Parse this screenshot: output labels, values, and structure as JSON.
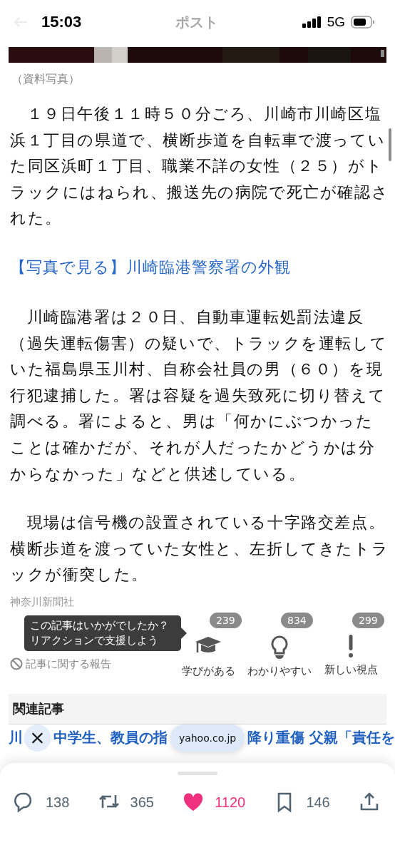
{
  "status_bar": {
    "time": "15:03",
    "network": "5G"
  },
  "header": {
    "title": "ポスト"
  },
  "article": {
    "photo_caption": "（資料写真）",
    "blocks": [
      {
        "kind": "paragraph",
        "text": "　１９日午後１１時５０分ごろ、川崎市川崎区塩浜１丁目の県道で、横断歩道を自転車で渡っていた同区浜町１丁目、職業不詳の女性（２５）がトラックにはねられ、搬送先の病院で死亡が確認された。"
      },
      {
        "kind": "link",
        "text": "【写真で見る】川崎臨港警察署の外観"
      },
      {
        "kind": "paragraph",
        "text": "　川崎臨港署は２０日、自動車運転処罰法違反（過失運転傷害）の疑いで、トラックを運転していた福島県玉川村、自称会社員の男（６０）を現行犯逮捕した。署は容疑を過失致死に切り替えて調べる。署によると、男は「何かにぶつかったことは確かだが、それが人だったかどうかは分からなかった」などと供述している。"
      },
      {
        "kind": "paragraph",
        "text": "　現場は信号機の設置されている十字路交差点。横断歩道を渡っていた女性と、左折してきたトラックが衝突した。"
      }
    ],
    "source": "神奈川新聞社"
  },
  "reactions": {
    "prompt": [
      "この記事はいかがでしたか？",
      "リアクションで支援しよう"
    ],
    "items": [
      {
        "kind": "learn",
        "label": "学びがある",
        "count": "239"
      },
      {
        "kind": "clear",
        "label": "わかりやすい",
        "count": "834"
      },
      {
        "kind": "new",
        "label": "新しい視点",
        "count": "299"
      }
    ],
    "report": "記事に関する報告"
  },
  "related": {
    "title": "関連記事",
    "visible_parts": [
      "川",
      "中学生、教員の指",
      "降り重傷 父親「責任を"
    ]
  },
  "browser_overlay": {
    "site": "yahoo.co.jp"
  },
  "actions": [
    {
      "kind": "reply",
      "count": "138",
      "selected": false
    },
    {
      "kind": "repost",
      "count": "365",
      "selected": false
    },
    {
      "kind": "like",
      "count": "1120",
      "selected": true
    },
    {
      "kind": "bookmark",
      "count": "146",
      "selected": false
    },
    {
      "kind": "share"
    }
  ]
}
